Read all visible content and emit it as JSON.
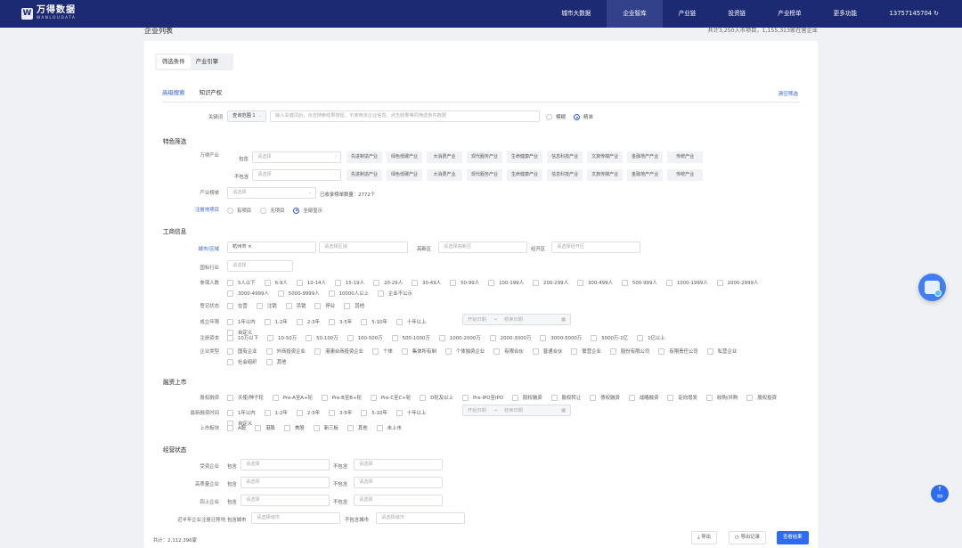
{
  "logo": {
    "main": "万得数据",
    "sub": "WANLOUDATA"
  },
  "nav": [
    "城市大数据",
    "企业智库",
    "产业链",
    "投资链",
    "产业榜单",
    "更多功能"
  ],
  "phone": "13757145704",
  "page": {
    "title": "企业列表",
    "total_top": "共计3,250入市项目，1,155,313家在营企业"
  },
  "filter_tabs": [
    "筛选条件",
    "产业引擎"
  ],
  "sub_tabs": [
    "高级搜索",
    "知识产权"
  ],
  "clear": "清空筛选",
  "keyword": {
    "label": "关键词",
    "scope": "查询范围 1",
    "placeholder": "输入关键词后，点击搜索结果按钮，不使用该企业信息，点击结果等同筛选条件数据",
    "fuzzy": "模糊",
    "exact": "精准"
  },
  "feature": {
    "title": "特色筛选",
    "wande_label": "万得产业",
    "include": "包含",
    "exclude": "不包含",
    "select_ph": "请选择",
    "industries": [
      "先进制造产业",
      "绿色低碳产业",
      "大消费产业",
      "现代服务产业",
      "生命健康产业",
      "信息科技产业",
      "文旅传媒产业",
      "金融地产产业",
      "传统产业"
    ],
    "chain_label": "产业榜单",
    "chain_note": "已收录榜单数量：2772个",
    "focus_label": "注册地项目",
    "focus_opts": [
      "有项目",
      "无项目",
      "全部显示"
    ]
  },
  "biz": {
    "title": "工商信息",
    "city_label": "城市/区域",
    "city_value": "杭州市",
    "district_ph": "请选择区域",
    "hightech_label": "高新区",
    "hightech_ph": "请选择高新区",
    "econ_label": "经开区",
    "econ_ph": "请选择经开区",
    "industry_label": "国标行业",
    "industry_ph": "请选择",
    "staff_label": "参保人数",
    "staff_opts": [
      "5人以下",
      "6-9人",
      "10-14人",
      "15-19人",
      "20-29人",
      "30-49人",
      "50-99人",
      "100-199人",
      "200-299人",
      "300-499人",
      "500-999人",
      "1000-1999人",
      "2000-2999人",
      "3000-4999人",
      "5000-9999人",
      "10000人以上",
      "企业不公示"
    ],
    "status_label": "登记状态",
    "status_opts": [
      "在营",
      "注销",
      "吊销",
      "停业",
      "其他"
    ],
    "year_label": "成立年限",
    "year_opts": [
      "1年以内",
      "1-2年",
      "2-3年",
      "3-5年",
      "5-10年",
      "十年以上",
      "自定义"
    ],
    "start_ph": "开始日期",
    "end_ph": "结束日期",
    "capital_label": "注册资本",
    "capital_opts": [
      "10万以下",
      "10-50万",
      "50-100万",
      "100-500万",
      "500-1000万",
      "1000-2000万",
      "2000-3000万",
      "3000-5000万",
      "5000万-1亿",
      "1亿以上"
    ],
    "type_label": "企业类型",
    "type_opts": [
      "国有企业",
      "外商投资企业",
      "港澳台商投资企业",
      "个体",
      "集体所有制",
      "个体独资企业",
      "有限合伙",
      "普通合伙",
      "联营企业",
      "股份有限公司",
      "有限责任公司",
      "私营企业",
      "社会组织",
      "其他"
    ]
  },
  "finance": {
    "title": "融资上市",
    "round_label": "股权融资",
    "round_opts": [
      "天使/种子轮",
      "Pre-A至A+轮",
      "Pre-B至B+轮",
      "Pre-C至C+轮",
      "D轮及以上",
      "Pre-IPO至IPO",
      "股权融资",
      "股权转让",
      "债权融资",
      "战略融资",
      "定向增发",
      "收购/并购",
      "股权投资"
    ],
    "recent_label": "最新融资时间",
    "recent_opts": [
      "1年以内",
      "1-2年",
      "2-3年",
      "3-5年",
      "5-10年",
      "十年以上",
      "自定义"
    ],
    "list_label": "上市板块",
    "list_opts": [
      "A股",
      "港股",
      "美股",
      "新三板",
      "其他",
      "未上市"
    ]
  },
  "ops": {
    "title": "经营状态",
    "rows": [
      {
        "label": "受资企业"
      },
      {
        "label": "高质量企业"
      },
      {
        "label": "四上企业"
      }
    ],
    "include": "包含",
    "exclude": "不包含",
    "select_ph": "请选择",
    "move_label": "近半年企业注册迁移地",
    "inc_city": "包含城市",
    "exc_city": "不包含城市",
    "city_ph": "请选择城市"
  },
  "bottom": {
    "total": "共计：2,112,396家",
    "export": "导出",
    "history": "导出记录",
    "view": "查看结果"
  },
  "side": {
    "top_label": "顶部"
  },
  "colors": {
    "nav_bg": "#1b2a73",
    "accent": "#2d6cf0"
  }
}
